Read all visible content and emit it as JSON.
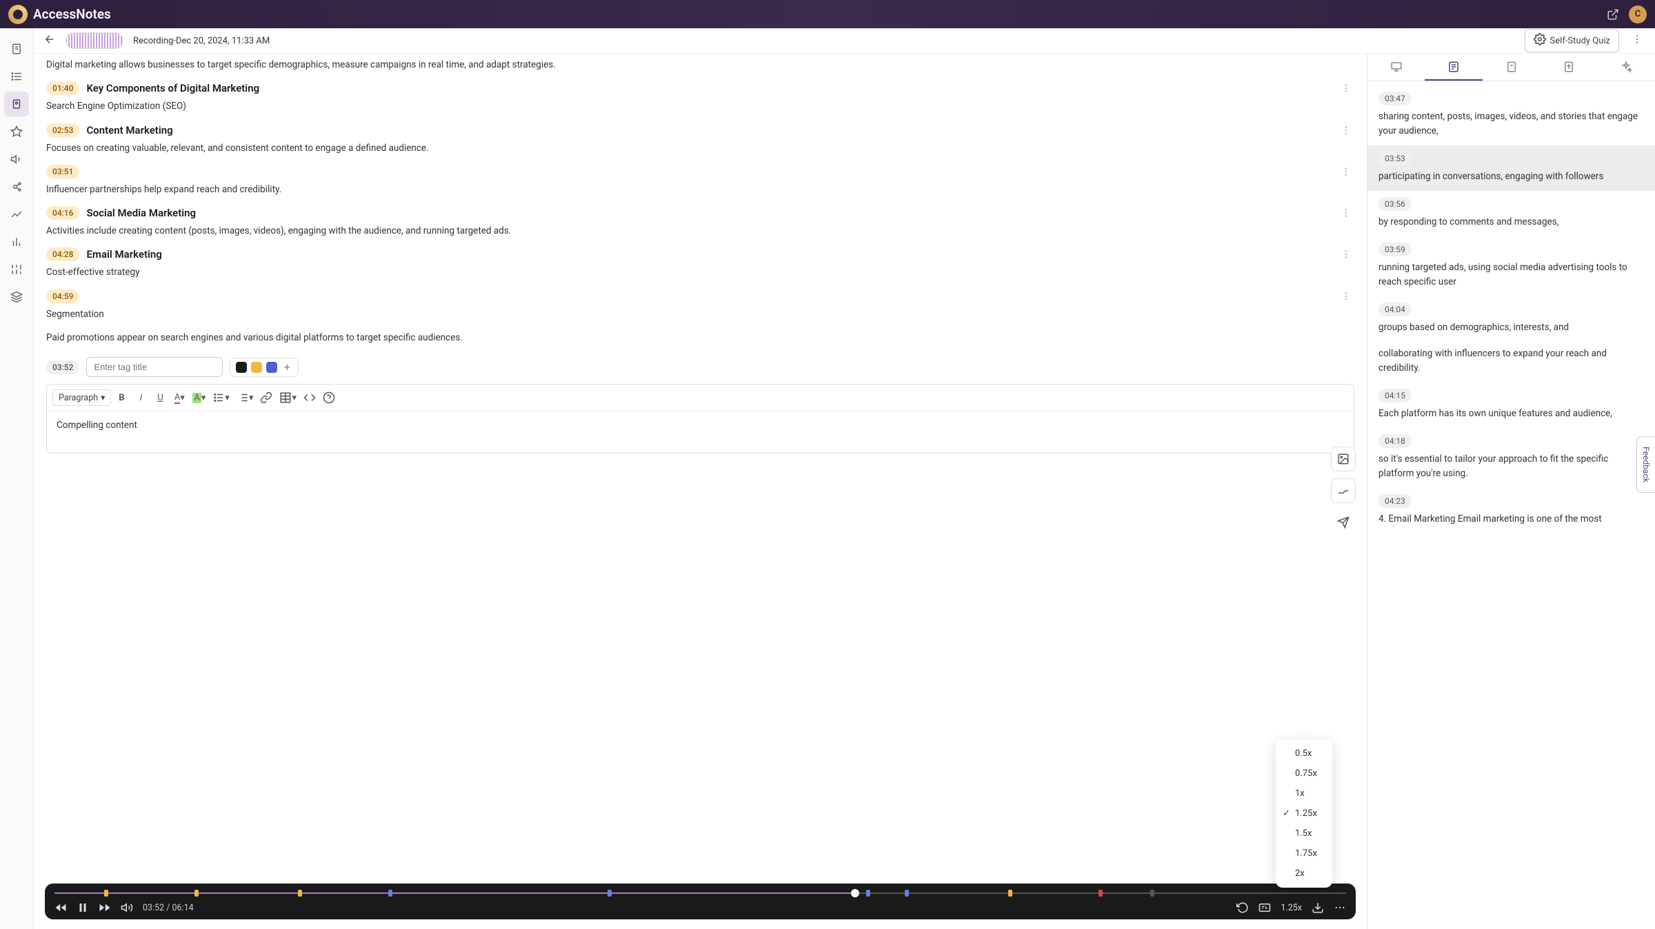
{
  "app": {
    "name": "AccessNotes",
    "avatar_initial": "C"
  },
  "toolbar": {
    "recording_title": "Recording-Dec 20, 2024, 11:33 AM",
    "quiz_label": "Self-Study Quiz"
  },
  "notes": {
    "intro": "Digital marketing allows businesses to target specific demographics, measure campaigns in real time, and adapt strategies.",
    "sections": [
      {
        "ts": "01:40",
        "title": "Key Components of Digital Marketing",
        "body": "Search Engine Optimization (SEO)"
      },
      {
        "ts": "02:53",
        "title": "Content Marketing",
        "body": "Focuses on creating valuable, relevant, and consistent content to engage a defined audience."
      },
      {
        "ts": "03:51",
        "title": "",
        "body": "Influencer partnerships help expand reach and credibility."
      },
      {
        "ts": "04:16",
        "title": "Social Media Marketing",
        "body": "Activities include creating content (posts, images, videos), engaging with the audience, and running targeted ads."
      },
      {
        "ts": "04:28",
        "title": "Email Marketing",
        "body": "Cost-effective strategy"
      },
      {
        "ts": "04:59",
        "title": "",
        "body": "Segmentation"
      }
    ],
    "extra": "Paid promotions appear on search engines and various digital platforms to target specific audiences."
  },
  "tag": {
    "ts": "03:52",
    "placeholder": "Enter tag title",
    "colors": [
      "#1a1a1a",
      "#f0b840",
      "#4a5fd0"
    ]
  },
  "editor": {
    "style_label": "Paragraph",
    "content": "Compelling content"
  },
  "speed_menu": {
    "options": [
      "0.5x",
      "0.75x",
      "1x",
      "1.25x",
      "1.5x",
      "1.75x",
      "2x"
    ],
    "selected": "1.25x"
  },
  "player": {
    "current": "03:52",
    "total": "06:14",
    "speed": "1.25x",
    "progress_pct": 62,
    "markers": [
      {
        "pos": 4,
        "color": "#f0b840"
      },
      {
        "pos": 11,
        "color": "#f0b840"
      },
      {
        "pos": 19,
        "color": "#f0b840"
      },
      {
        "pos": 26,
        "color": "#6a7de0"
      },
      {
        "pos": 43,
        "color": "#6a7de0"
      },
      {
        "pos": 63,
        "color": "#6a7de0"
      },
      {
        "pos": 66,
        "color": "#6a7de0"
      },
      {
        "pos": 74,
        "color": "#f0b840"
      },
      {
        "pos": 81,
        "color": "#e04040"
      },
      {
        "pos": 85,
        "color": "#555"
      }
    ]
  },
  "transcript": [
    {
      "ts": "03:47",
      "text": "sharing content, posts, images, videos, and stories that engage your audience,",
      "hl": false
    },
    {
      "ts": "03:53",
      "text": "participating in conversations, engaging with followers",
      "hl": true
    },
    {
      "ts": "03:56",
      "text": "by responding to comments and messages,",
      "hl": false
    },
    {
      "ts": "03:59",
      "text": "running targeted ads, using social media advertising tools to reach specific user",
      "hl": false
    },
    {
      "ts": "04:04",
      "text": "groups based on demographics, interests, and",
      "hl": false
    },
    {
      "ts": "",
      "text": "collaborating with influencers to expand your reach and credibility.",
      "hl": false
    },
    {
      "ts": "04:15",
      "text": "Each platform has its own unique features and audience,",
      "hl": false
    },
    {
      "ts": "04:18",
      "text": "so it's essential to tailor your approach to fit the specific platform you're using.",
      "hl": false
    },
    {
      "ts": "04:23",
      "text": "4. Email Marketing Email marketing is one of the most",
      "hl": false
    }
  ],
  "feedback_label": "Feedback"
}
